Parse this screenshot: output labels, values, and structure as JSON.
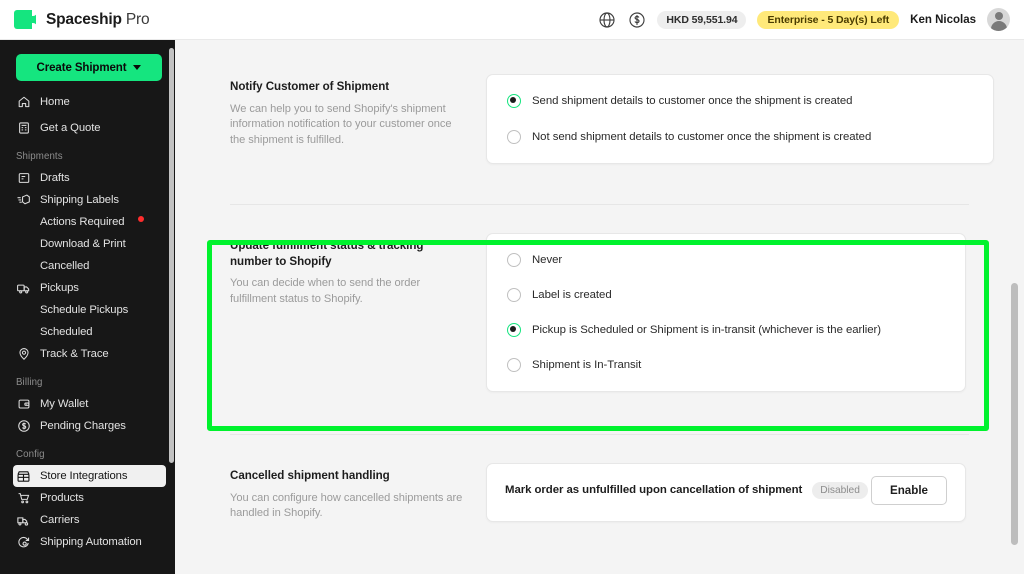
{
  "header": {
    "brand_name": "Spaceship",
    "brand_suffix": "Pro",
    "globe_icon": "globe-icon",
    "currency_icon": "dollar-circle-icon",
    "balance": "HKD 59,551.94",
    "plan_badge": "Enterprise - 5 Day(s) Left",
    "user_name": "Ken Nicolas",
    "avatar_icon": "user-avatar-icon"
  },
  "sidebar": {
    "create_button": "Create Shipment",
    "items": [
      {
        "label": "Home",
        "icon": "home-icon",
        "type": "item"
      },
      {
        "label": "Get a Quote",
        "icon": "quote-icon",
        "type": "item"
      },
      {
        "label": "Shipments",
        "type": "group"
      },
      {
        "label": "Drafts",
        "icon": "drafts-icon",
        "type": "item"
      },
      {
        "label": "Shipping Labels",
        "icon": "shipping-labels-icon",
        "type": "item"
      },
      {
        "label": "Actions Required",
        "type": "sub",
        "badge": "alert-dot"
      },
      {
        "label": "Download & Print",
        "type": "sub"
      },
      {
        "label": "Cancelled",
        "type": "sub"
      },
      {
        "label": "Pickups",
        "icon": "truck-icon",
        "type": "item"
      },
      {
        "label": "Schedule Pickups",
        "type": "sub"
      },
      {
        "label": "Scheduled",
        "type": "sub"
      },
      {
        "label": "Track & Trace",
        "icon": "location-pin-icon",
        "type": "item"
      },
      {
        "label": "Billing",
        "type": "group"
      },
      {
        "label": "My Wallet",
        "icon": "wallet-icon",
        "type": "item"
      },
      {
        "label": "Pending Charges",
        "icon": "dollar-circle-icon",
        "type": "item"
      },
      {
        "label": "Config",
        "type": "group"
      },
      {
        "label": "Store Integrations",
        "icon": "store-icon",
        "type": "item",
        "active": true
      },
      {
        "label": "Products",
        "icon": "cart-icon",
        "type": "item"
      },
      {
        "label": "Carriers",
        "icon": "carriers-icon",
        "type": "item"
      },
      {
        "label": "Shipping Automation",
        "icon": "automation-icon",
        "type": "item"
      }
    ]
  },
  "main": {
    "sections": [
      {
        "id": "notify-customer",
        "title": "Notify Customer of Shipment",
        "description": "We can help you to send Shopify's shipment information notification to your customer once the shipment is fulfilled.",
        "options": [
          {
            "label": "Send shipment details to customer once the shipment is created",
            "checked": true
          },
          {
            "label": "Not send shipment details to customer once the shipment is created",
            "checked": false
          }
        ]
      },
      {
        "id": "update-fulfillment-status",
        "title": "Update fulfillment status & tracking number to Shopify",
        "description": "You can decide when to send the order fulfillment status to Shopify.",
        "highlighted": true,
        "options": [
          {
            "label": "Never",
            "checked": false
          },
          {
            "label": "Label is created",
            "checked": false
          },
          {
            "label": "Pickup is Scheduled or Shipment is in-transit (whichever is the earlier)",
            "checked": true
          },
          {
            "label": "Shipment is In-Transit",
            "checked": false
          }
        ]
      },
      {
        "id": "cancelled-shipment-handling",
        "title": "Cancelled shipment handling",
        "description": "You can configure how cancelled shipments are handled in Shopify.",
        "row_text": "Mark order as unfulfilled upon cancellation of shipment",
        "row_badge": "Disabled",
        "row_button": "Enable"
      }
    ]
  },
  "colors": {
    "accent_green": "#15e57f",
    "highlight_green": "#00f22d",
    "plan_badge_yellow": "#ffe97a",
    "alert_red": "#ff2d2d",
    "sidebar_bg": "#171717",
    "page_bg": "#f4f4f4"
  }
}
